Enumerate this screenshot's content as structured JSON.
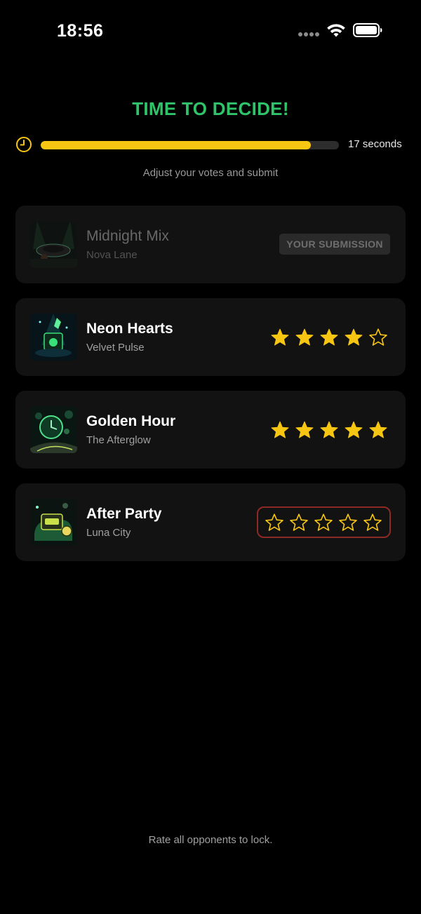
{
  "status_bar": {
    "time": "18:56"
  },
  "header": {
    "title": "TIME TO DECIDE!",
    "timer_label": "17 seconds",
    "progress_fraction": 0.905,
    "instruction": "Adjust your votes and submit"
  },
  "own_submission": {
    "title": "Midnight Mix",
    "artist": "Nova Lane",
    "badge": "YOUR SUBMISSION"
  },
  "opponents": [
    {
      "title": "Neon Hearts",
      "artist": "Velvet Pulse",
      "rating": 4,
      "max": 5,
      "highlighted": false
    },
    {
      "title": "Golden Hour",
      "artist": "The Afterglow",
      "rating": 5,
      "max": 5,
      "highlighted": false
    },
    {
      "title": "After Party",
      "artist": "Luna City",
      "rating": 0,
      "max": 5,
      "highlighted": true
    }
  ],
  "footer": {
    "note": "Rate all opponents to lock."
  },
  "colors": {
    "accent_green": "#30c46a",
    "star_gold": "#f7c613",
    "highlight_border": "#8d2a25",
    "card_bg": "#121212"
  },
  "icons": [
    "clock-icon",
    "wifi-icon",
    "battery-icon",
    "star-icon"
  ]
}
